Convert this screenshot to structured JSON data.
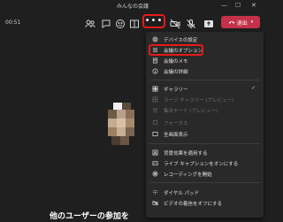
{
  "window": {
    "title": "みんなの会議",
    "minimize": "—",
    "maximize": "☐",
    "close": "✕"
  },
  "toolbar": {
    "timer": "00:51",
    "more_label": "•••",
    "leave_label": "退出"
  },
  "menu": {
    "items": [
      {
        "label": "デバイスの設定"
      },
      {
        "label": "会議のオプション"
      },
      {
        "label": "会議のメモ"
      },
      {
        "label": "会議の詳細"
      },
      {
        "label": "ギャラリー",
        "checked": true
      },
      {
        "label": "ラージ ギャラリー (プレビュー)"
      },
      {
        "label": "集合モード (プレビュー)"
      },
      {
        "label": "フォーカス"
      },
      {
        "label": "全画面表示"
      },
      {
        "label": "背景効果を適用する"
      },
      {
        "label": "ライブ キャプションをオンにする"
      },
      {
        "label": "レコーディングを開始"
      },
      {
        "label": "ダイヤル パッド"
      },
      {
        "label": "ビデオの着信をオフにする"
      }
    ],
    "check_mark": "✓"
  },
  "stage": {
    "waiting_text": "他のユーザーの参加を"
  }
}
